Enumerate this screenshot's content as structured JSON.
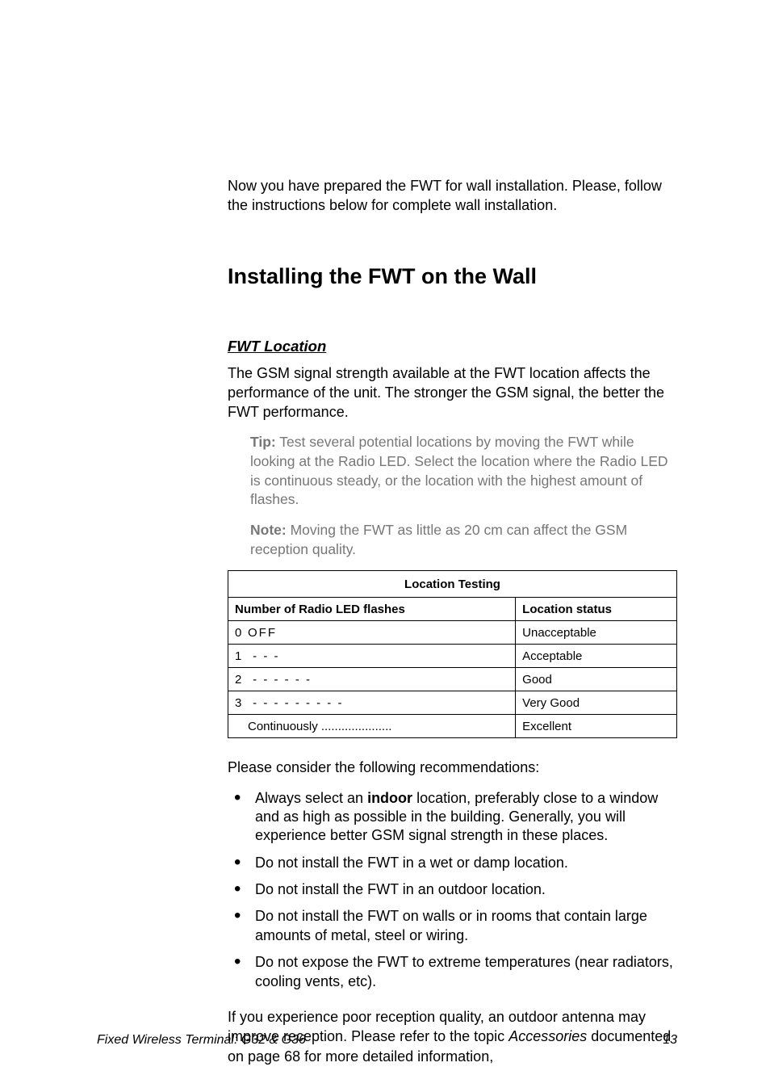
{
  "intro": "Now you have prepared the FWT for wall installation. Please, follow the instructions below for complete wall installation.",
  "heading": "Installing the FWT on the Wall",
  "subheading": "FWT Location",
  "loc_para": "The GSM signal strength available at the FWT location affects the performance of the unit. The stronger the GSM signal, the better the FWT performance.",
  "tip_label": "Tip:",
  "tip_body": " Test several potential locations by moving the FWT while looking at the Radio LED. Select the location where the Radio LED is continuous steady, or the location with the highest amount of flashes.",
  "note_label": "Note:",
  "note_body": " Moving the FWT as little as 20 cm can affect the GSM reception quality.",
  "table": {
    "caption": "Location Testing",
    "col1": "Number of Radio LED flashes",
    "col2": "Location status",
    "rows": [
      {
        "flashes_num": "0",
        "flashes_pat": "OFF",
        "status": "Unacceptable"
      },
      {
        "flashes_num": "1",
        "flashes_pat": "  -         -        -",
        "status": "Acceptable"
      },
      {
        "flashes_num": "2",
        "flashes_pat": "  - -       - -      - -",
        "status": "Good"
      },
      {
        "flashes_num": "3",
        "flashes_pat": "  - - -     - - -    - - -",
        "status": "Very Good"
      },
      {
        "flashes_num": "",
        "flashes_pat": "Continuously .....................",
        "status": "Excellent"
      }
    ]
  },
  "rec_intro": "Please consider the following recommendations:",
  "bullets": {
    "b1_pre": "Always select an ",
    "b1_bold": "indoor",
    "b1_post": " location, preferably close to a window and as high as possible in the building. Generally, you will experience better GSM signal strength in these places.",
    "b2": "Do not install the FWT in a wet or damp location.",
    "b3": "Do not install the FWT in an outdoor location.",
    "b4": "Do not install the FWT on walls or in rooms that contain large amounts of metal, steel or wiring.",
    "b5": "Do not expose the FWT to extreme temperatures (near radiators, cooling vents, etc)."
  },
  "closing_pre": "If you experience poor reception quality, an outdoor antenna may improve reception. Please refer to the topic ",
  "closing_ital": "Accessories",
  "closing_post": " documented on page 68 for more detailed information,",
  "footer_title": "Fixed Wireless Terminal: G32 & G36",
  "footer_page": "13"
}
